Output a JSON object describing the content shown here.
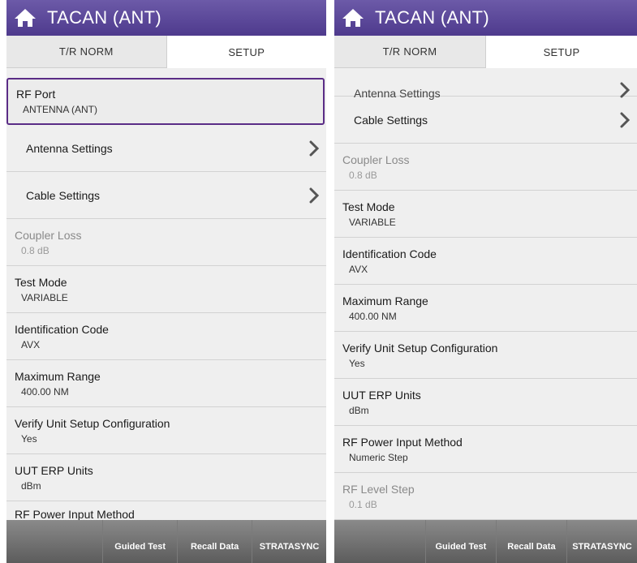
{
  "left": {
    "title": "TACAN (ANT)",
    "tabs": [
      {
        "label": "T/R NORM",
        "active": false
      },
      {
        "label": "SETUP",
        "active": true
      }
    ],
    "rf_port": {
      "label": "RF Port",
      "value": "ANTENNA (ANT)"
    },
    "antenna_settings": {
      "label": "Antenna Settings"
    },
    "cable_settings": {
      "label": "Cable Settings"
    },
    "coupler_loss": {
      "label": "Coupler Loss",
      "value": "0.8 dB"
    },
    "test_mode": {
      "label": "Test Mode",
      "value": "VARIABLE"
    },
    "identification_code": {
      "label": "Identification Code",
      "value": "AVX"
    },
    "maximum_range": {
      "label": "Maximum Range",
      "value": "400.00 NM"
    },
    "verify_unit_setup": {
      "label": "Verify Unit Setup Configuration",
      "value": "Yes"
    },
    "uut_erp_units": {
      "label": "UUT ERP Units",
      "value": "dBm"
    },
    "rf_power_input_method": {
      "label": "RF Power Input Method"
    },
    "bottom": {
      "guided_test": "Guided Test",
      "recall_data": "Recall Data",
      "stratasync": "STRATASYNC"
    }
  },
  "right": {
    "title": "TACAN (ANT)",
    "tabs": [
      {
        "label": "T/R NORM",
        "active": false
      },
      {
        "label": "SETUP",
        "active": true
      }
    ],
    "antenna_settings_partial": {
      "label": "Antenna Settings"
    },
    "cable_settings": {
      "label": "Cable Settings"
    },
    "coupler_loss": {
      "label": "Coupler Loss",
      "value": "0.8 dB"
    },
    "test_mode": {
      "label": "Test Mode",
      "value": "VARIABLE"
    },
    "identification_code": {
      "label": "Identification Code",
      "value": "AVX"
    },
    "maximum_range": {
      "label": "Maximum Range",
      "value": "400.00 NM"
    },
    "verify_unit_setup": {
      "label": "Verify Unit Setup Configuration",
      "value": "Yes"
    },
    "uut_erp_units": {
      "label": "UUT ERP Units",
      "value": "dBm"
    },
    "rf_power_input_method": {
      "label": "RF Power Input Method",
      "value": "Numeric Step"
    },
    "rf_level_step": {
      "label": "RF Level Step",
      "value": "0.1 dB"
    },
    "bottom": {
      "guided_test": "Guided Test",
      "recall_data": "Recall Data",
      "stratasync": "STRATASYNC"
    }
  },
  "colors": {
    "title_bar": "#5a469a",
    "selected_border": "#5a2c86",
    "bottom_bar": "#6e6e6e"
  },
  "icons": {
    "home": "home-icon",
    "chevron": "chevron-right-icon"
  }
}
